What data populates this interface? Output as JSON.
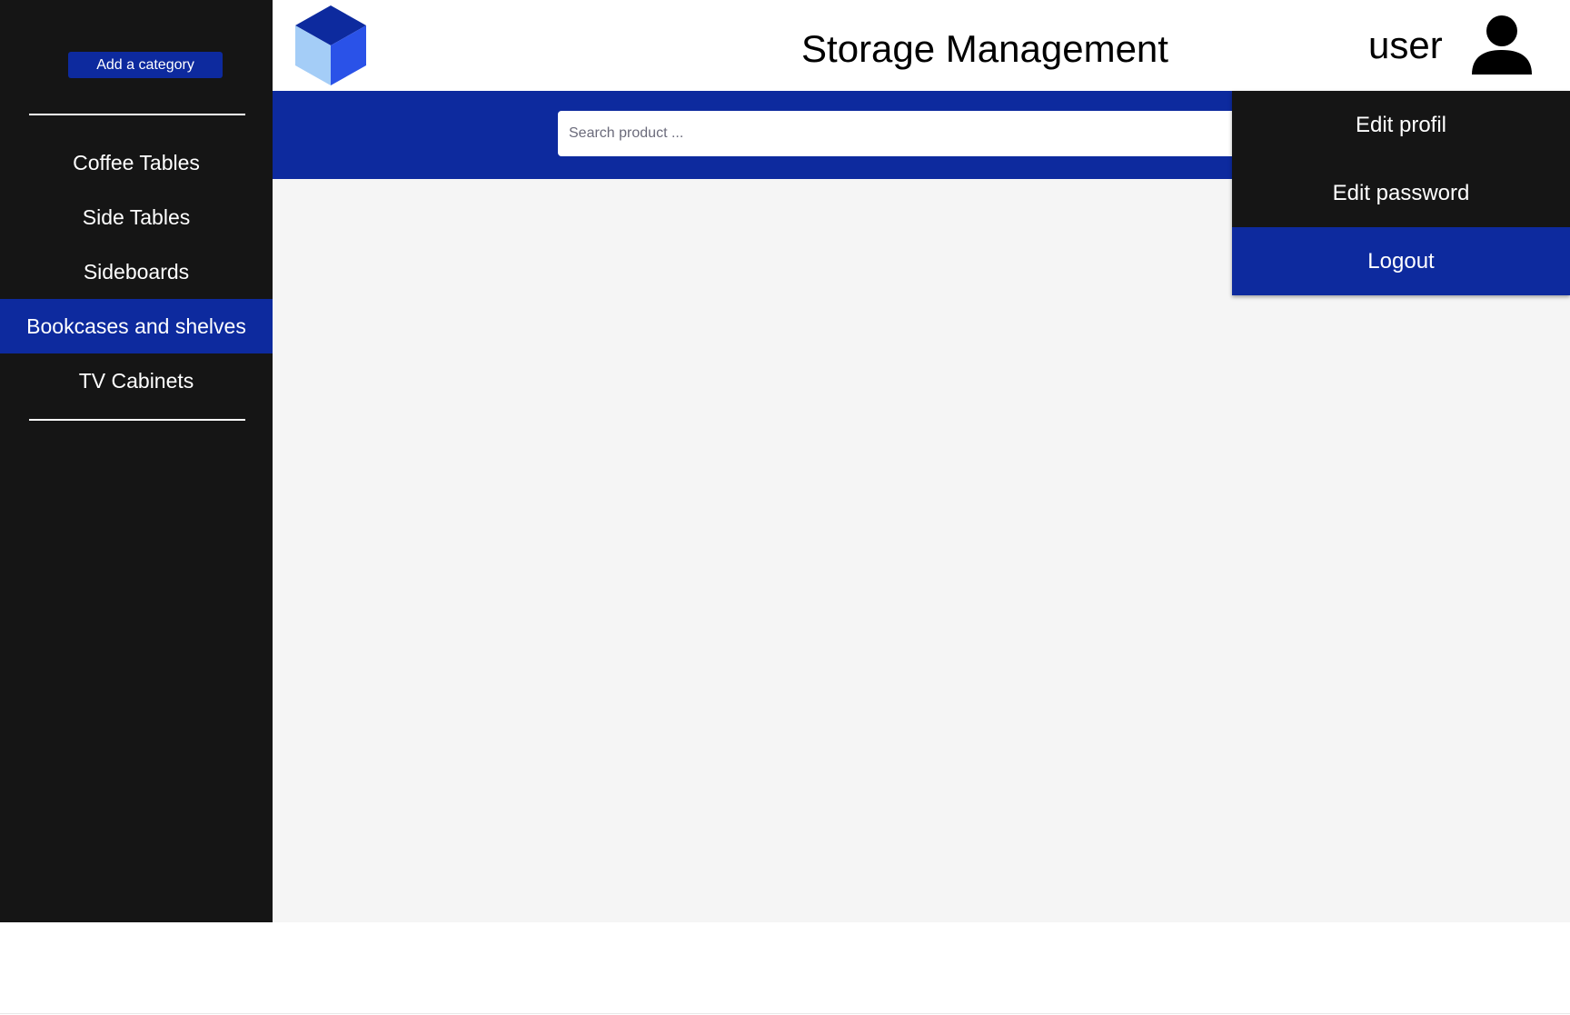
{
  "header": {
    "title": "Storage Management",
    "user_name": "user",
    "logo_icon": "cube-icon",
    "user_icon": "user-avatar-icon"
  },
  "sidebar": {
    "add_button_label": "Add a category",
    "categories": [
      {
        "label": "Coffee Tables",
        "active": false
      },
      {
        "label": "Side Tables",
        "active": false
      },
      {
        "label": "Sideboards",
        "active": false
      },
      {
        "label": "Bookcases and shelves",
        "active": true
      },
      {
        "label": "TV Cabinets",
        "active": false
      }
    ]
  },
  "search": {
    "placeholder": "Search product ...",
    "value": ""
  },
  "user_menu": {
    "items": [
      {
        "label": "Edit profil"
      },
      {
        "label": "Edit password"
      },
      {
        "label": "Logout"
      }
    ]
  },
  "colors": {
    "primary_blue": "#0d2a9e",
    "sidebar_bg": "#151515",
    "content_bg": "#f5f5f5",
    "logo_top": "#0d2a9e",
    "logo_left": "#a4cdf7",
    "logo_right": "#2a52e8"
  }
}
